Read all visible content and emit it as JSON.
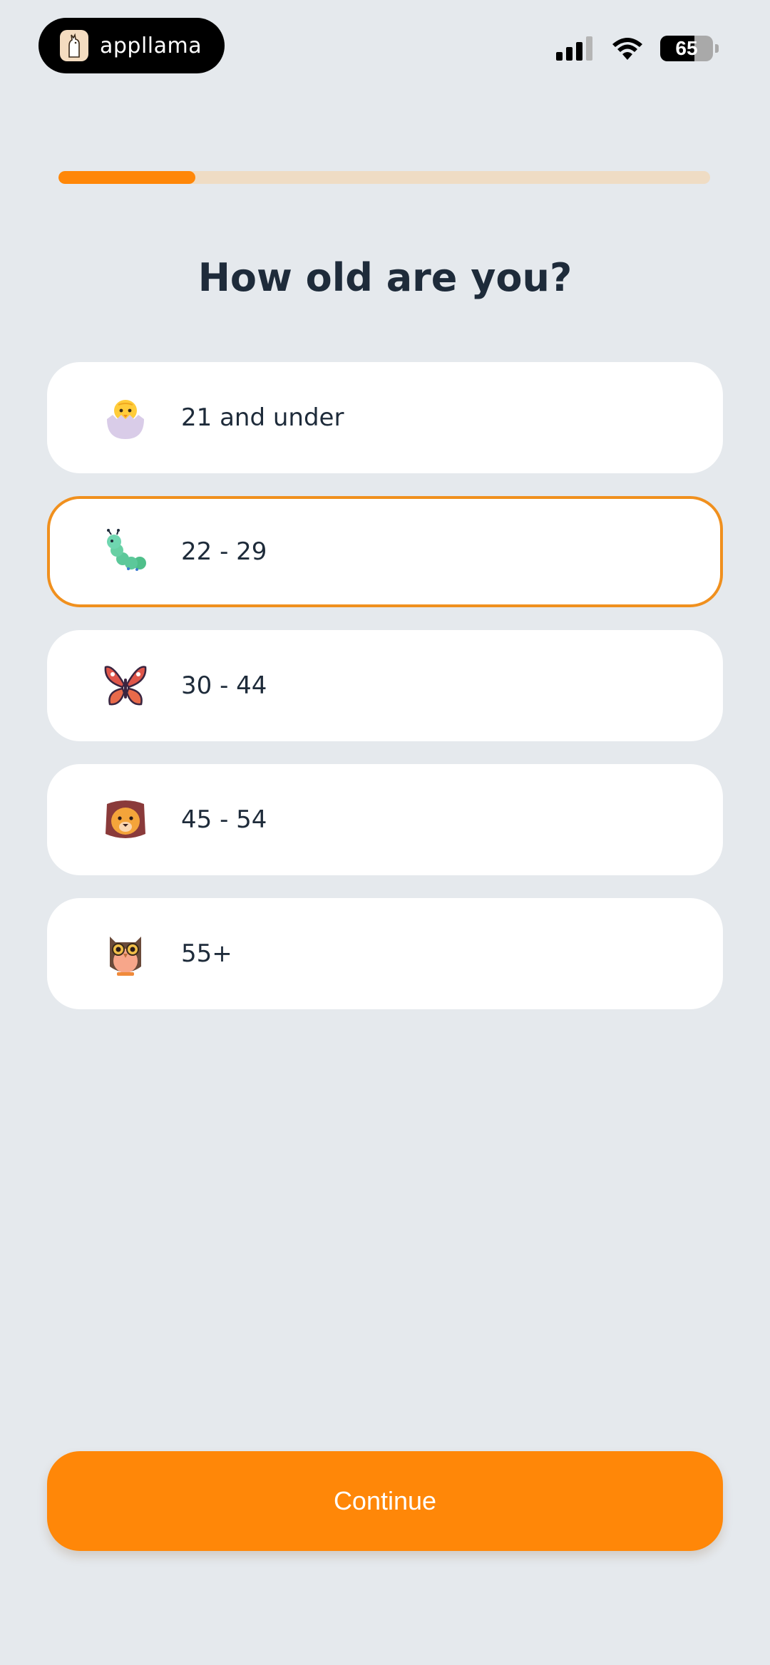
{
  "status_bar": {
    "app_name": "appllama",
    "battery_level": "65"
  },
  "onboarding": {
    "progress_fraction": 0.21,
    "question": "How old are you?",
    "options": [
      {
        "label": "21 and under",
        "icon": "hatching-chick-icon",
        "selected": false
      },
      {
        "label": "22 - 29",
        "icon": "caterpillar-icon",
        "selected": true
      },
      {
        "label": "30 - 44",
        "icon": "butterfly-icon",
        "selected": false
      },
      {
        "label": "45 - 54",
        "icon": "lion-icon",
        "selected": false
      },
      {
        "label": "55+",
        "icon": "owl-icon",
        "selected": false
      }
    ],
    "continue_label": "Continue"
  },
  "colors": {
    "accent": "#ff8708",
    "background": "#e5e9ed",
    "progress_track": "#efdcc4"
  }
}
